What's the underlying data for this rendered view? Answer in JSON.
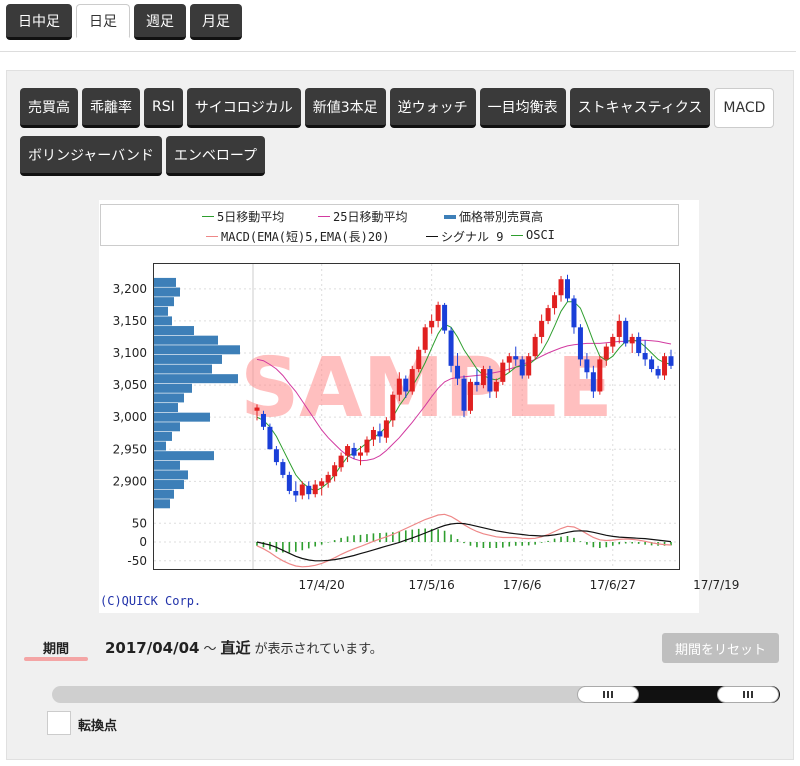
{
  "top_tabs": [
    {
      "label": "日中足",
      "active": false
    },
    {
      "label": "日足",
      "active": true
    },
    {
      "label": "週足",
      "active": false
    },
    {
      "label": "月足",
      "active": false
    }
  ],
  "indicator_tabs_row1": [
    {
      "label": "売買高",
      "active": false
    },
    {
      "label": "乖離率",
      "active": false
    },
    {
      "label": "RSI",
      "active": false
    },
    {
      "label": "サイコロジカル",
      "active": false
    },
    {
      "label": "新値3本足",
      "active": false
    },
    {
      "label": "逆ウォッチ",
      "active": false
    },
    {
      "label": "一目均衡表",
      "active": false
    },
    {
      "label": "ストキャスティクス",
      "active": false
    },
    {
      "label": "MACD",
      "active": true
    }
  ],
  "indicator_tabs_row2": [
    {
      "label": "ボリンジャーバンド",
      "active": false
    },
    {
      "label": "エンベロープ",
      "active": false
    }
  ],
  "legend": {
    "ma5": "5日移動平均",
    "ma25": "25日移動平均",
    "volume_profile": "価格帯別売買高",
    "macd": "MACD(EMA(短)5,EMA(長)20)",
    "signal": "シグナル 9",
    "osci": "OSCI"
  },
  "watermark": "SAMPLE",
  "copyright": "(C)QUICK Corp.",
  "period": {
    "label": "期間",
    "start": "2017/04/04",
    "separator": "～",
    "end": "直近",
    "suffix": "が表示されています。",
    "reset_label": "期間をリセット",
    "range_fraction": [
      0.72,
      1.0
    ]
  },
  "turning_point": {
    "label": "転換点",
    "checked": false
  },
  "colors": {
    "up": "#e02020",
    "down": "#1a3fd8",
    "ma5": "#2e9e2e",
    "ma25": "#d23aa0",
    "macd": "#ee8888",
    "signal": "#111111",
    "osci": "#2e9e2e",
    "volume": "#3d7fb8",
    "watermark": "#ff8a8a"
  },
  "chart_data": {
    "type": "candlestick",
    "price_axis": {
      "ticks": [
        "3,200",
        "3,150",
        "3,100",
        "3,050",
        "3,000",
        "2,950",
        "2,900"
      ],
      "values": [
        3200,
        3150,
        3100,
        3050,
        3000,
        2950,
        2900
      ],
      "range": [
        2860,
        3220
      ]
    },
    "macd_axis": {
      "ticks": [
        "50",
        "0",
        "-50"
      ],
      "values": [
        50,
        0,
        -50
      ],
      "range": [
        -80,
        80
      ]
    },
    "x_axis": {
      "ticks": [
        "17/4/20",
        "17/5/16",
        "17/6/6",
        "17/6/27",
        "17/7/19"
      ],
      "tick_index": [
        10,
        27,
        41,
        55,
        71
      ]
    },
    "candles": [
      [
        3010,
        3020,
        2995,
        3015
      ],
      [
        3005,
        3010,
        2980,
        2985
      ],
      [
        2985,
        2990,
        2950,
        2950
      ],
      [
        2950,
        2955,
        2925,
        2930
      ],
      [
        2930,
        2935,
        2905,
        2910
      ],
      [
        2910,
        2915,
        2880,
        2885
      ],
      [
        2885,
        2900,
        2868,
        2878
      ],
      [
        2878,
        2900,
        2872,
        2895
      ],
      [
        2893,
        2900,
        2872,
        2880
      ],
      [
        2880,
        2902,
        2875,
        2895
      ],
      [
        2893,
        2905,
        2878,
        2900
      ],
      [
        2898,
        2915,
        2890,
        2910
      ],
      [
        2908,
        2930,
        2900,
        2925
      ],
      [
        2922,
        2945,
        2915,
        2940
      ],
      [
        2940,
        2958,
        2930,
        2955
      ],
      [
        2952,
        2960,
        2935,
        2940
      ],
      [
        2940,
        2955,
        2925,
        2945
      ],
      [
        2945,
        2970,
        2940,
        2965
      ],
      [
        2965,
        2985,
        2955,
        2980
      ],
      [
        2978,
        2990,
        2960,
        2970
      ],
      [
        2968,
        3000,
        2960,
        2995
      ],
      [
        2995,
        3040,
        2985,
        3035
      ],
      [
        3035,
        3070,
        3025,
        3060
      ],
      [
        3060,
        3065,
        3030,
        3040
      ],
      [
        3040,
        3080,
        3035,
        3075
      ],
      [
        3075,
        3110,
        3070,
        3105
      ],
      [
        3105,
        3145,
        3100,
        3140
      ],
      [
        3140,
        3160,
        3130,
        3150
      ],
      [
        3150,
        3180,
        3140,
        3175
      ],
      [
        3175,
        3178,
        3130,
        3135
      ],
      [
        3135,
        3140,
        3070,
        3080
      ],
      [
        3080,
        3100,
        3050,
        3060
      ],
      [
        3060,
        3065,
        3000,
        3010
      ],
      [
        3010,
        3060,
        3005,
        3055
      ],
      [
        3055,
        3075,
        3040,
        3050
      ],
      [
        3050,
        3080,
        3045,
        3075
      ],
      [
        3075,
        3080,
        3030,
        3040
      ],
      [
        3040,
        3060,
        3030,
        3055
      ],
      [
        3055,
        3090,
        3050,
        3085
      ],
      [
        3085,
        3100,
        3070,
        3095
      ],
      [
        3095,
        3110,
        3080,
        3090
      ],
      [
        3090,
        3095,
        3060,
        3065
      ],
      [
        3065,
        3100,
        3060,
        3095
      ],
      [
        3095,
        3130,
        3090,
        3125
      ],
      [
        3125,
        3160,
        3115,
        3150
      ],
      [
        3150,
        3175,
        3145,
        3170
      ],
      [
        3170,
        3195,
        3160,
        3190
      ],
      [
        3190,
        3220,
        3180,
        3215
      ],
      [
        3215,
        3222,
        3180,
        3185
      ],
      [
        3185,
        3190,
        3130,
        3140
      ],
      [
        3140,
        3145,
        3080,
        3090
      ],
      [
        3090,
        3100,
        3060,
        3070
      ],
      [
        3070,
        3080,
        3030,
        3040
      ],
      [
        3040,
        3095,
        3035,
        3090
      ],
      [
        3090,
        3115,
        3080,
        3110
      ],
      [
        3110,
        3130,
        3100,
        3125
      ],
      [
        3125,
        3160,
        3115,
        3150
      ],
      [
        3150,
        3155,
        3110,
        3115
      ],
      [
        3115,
        3130,
        3100,
        3125
      ],
      [
        3125,
        3132,
        3095,
        3100
      ],
      [
        3100,
        3120,
        3080,
        3090
      ],
      [
        3090,
        3095,
        3070,
        3075
      ],
      [
        3075,
        3080,
        3060,
        3065
      ],
      [
        3065,
        3100,
        3058,
        3095
      ],
      [
        3095,
        3105,
        3075,
        3080
      ]
    ],
    "ma5": [
      3000,
      2995,
      2985,
      2970,
      2950,
      2930,
      2910,
      2898,
      2890,
      2885,
      2890,
      2898,
      2910,
      2925,
      2938,
      2945,
      2952,
      2960,
      2968,
      2975,
      2985,
      3000,
      3018,
      3032,
      3048,
      3065,
      3085,
      3108,
      3130,
      3145,
      3140,
      3125,
      3105,
      3090,
      3075,
      3065,
      3060,
      3058,
      3063,
      3070,
      3078,
      3080,
      3082,
      3090,
      3102,
      3120,
      3142,
      3165,
      3180,
      3180,
      3170,
      3145,
      3118,
      3095,
      3088,
      3095,
      3108,
      3118,
      3120,
      3118,
      3110,
      3100,
      3090,
      3085,
      3082
    ],
    "ma25": [
      3090,
      3088,
      3082,
      3075,
      3065,
      3052,
      3040,
      3025,
      3010,
      2995,
      2980,
      2968,
      2958,
      2948,
      2940,
      2935,
      2932,
      2933,
      2935,
      2940,
      2948,
      2958,
      2968,
      2980,
      2992,
      3005,
      3018,
      3032,
      3045,
      3055,
      3060,
      3062,
      3063,
      3064,
      3065,
      3066,
      3068,
      3070,
      3072,
      3075,
      3078,
      3082,
      3086,
      3090,
      3095,
      3100,
      3104,
      3108,
      3111,
      3113,
      3114,
      3115,
      3115,
      3115,
      3116,
      3117,
      3118,
      3118,
      3119,
      3120,
      3120,
      3119,
      3118,
      3116,
      3114
    ],
    "volume_profile": [
      {
        "price": 3210,
        "volume": 22
      },
      {
        "price": 3195,
        "volume": 26
      },
      {
        "price": 3180,
        "volume": 20
      },
      {
        "price": 3165,
        "volume": 14
      },
      {
        "price": 3150,
        "volume": 18
      },
      {
        "price": 3135,
        "volume": 40
      },
      {
        "price": 3120,
        "volume": 64
      },
      {
        "price": 3105,
        "volume": 86
      },
      {
        "price": 3090,
        "volume": 68
      },
      {
        "price": 3075,
        "volume": 58
      },
      {
        "price": 3060,
        "volume": 84
      },
      {
        "price": 3045,
        "volume": 38
      },
      {
        "price": 3030,
        "volume": 30
      },
      {
        "price": 3015,
        "volume": 24
      },
      {
        "price": 3000,
        "volume": 56
      },
      {
        "price": 2985,
        "volume": 26
      },
      {
        "price": 2970,
        "volume": 18
      },
      {
        "price": 2955,
        "volume": 12
      },
      {
        "price": 2940,
        "volume": 60
      },
      {
        "price": 2925,
        "volume": 26
      },
      {
        "price": 2910,
        "volume": 34
      },
      {
        "price": 2895,
        "volume": 30
      },
      {
        "price": 2880,
        "volume": 20
      },
      {
        "price": 2865,
        "volume": 16
      }
    ],
    "macd": [
      -10,
      -18,
      -28,
      -40,
      -50,
      -58,
      -64,
      -66,
      -65,
      -62,
      -57,
      -50,
      -42,
      -33,
      -25,
      -18,
      -12,
      -5,
      2,
      8,
      14,
      20,
      28,
      36,
      44,
      52,
      60,
      66,
      72,
      74,
      68,
      58,
      46,
      36,
      28,
      22,
      18,
      14,
      12,
      12,
      12,
      10,
      9,
      10,
      14,
      20,
      28,
      36,
      42,
      40,
      32,
      22,
      12,
      6,
      4,
      5,
      7,
      8,
      7,
      5,
      2,
      -2,
      -5,
      -7,
      -8
    ],
    "signal": [
      0,
      -4,
      -8,
      -14,
      -22,
      -30,
      -38,
      -44,
      -48,
      -50,
      -50,
      -49,
      -47,
      -44,
      -40,
      -36,
      -31,
      -26,
      -21,
      -16,
      -11,
      -6,
      -1,
      5,
      11,
      17,
      24,
      31,
      38,
      44,
      48,
      50,
      49,
      46,
      42,
      38,
      34,
      30,
      27,
      24,
      22,
      20,
      18,
      17,
      16,
      17,
      19,
      22,
      26,
      29,
      30,
      29,
      26,
      22,
      18,
      15,
      13,
      12,
      11,
      10,
      9,
      7,
      5,
      3,
      1
    ]
  }
}
